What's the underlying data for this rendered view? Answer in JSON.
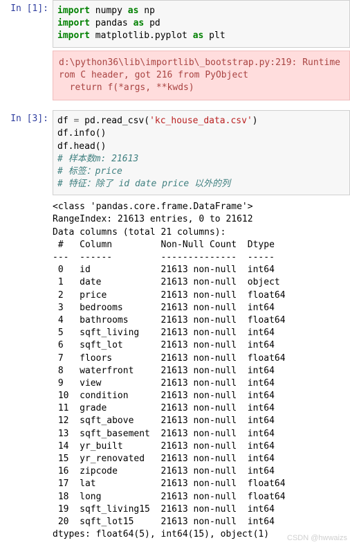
{
  "cell1": {
    "prompt": "In  [1]:",
    "lines": [
      {
        "kw": "import",
        "name": " numpy ",
        "as": "as",
        "alias": " np"
      },
      {
        "kw": "import",
        "name": " pandas ",
        "as": "as",
        "alias": " pd"
      },
      {
        "kw": "import",
        "name": " matplotlib.pyplot ",
        "as": "as",
        "alias": " plt"
      }
    ]
  },
  "warning": {
    "line1": "d:\\python36\\lib\\importlib\\_bootstrap.py:219: Runtime",
    "line2": "rom C header, got 216 from PyObject",
    "line3": "  return f(*args, **kwds)"
  },
  "cell3": {
    "prompt": "In  [3]:",
    "line1_pre": "df ",
    "line1_eq": "=",
    "line1_mid": " pd.read_csv(",
    "line1_str": "'kc_house_data.csv'",
    "line1_end": ")",
    "line2": "df.info()",
    "line3": "df.head()",
    "line4": "# 样本数m: 21613",
    "line5": "# 标签：price",
    "line6": "# 特征：除了 id date price 以外的列"
  },
  "output": {
    "header1": "<class 'pandas.core.frame.DataFrame'>",
    "header2": "RangeIndex: 21613 entries, 0 to 21612",
    "header3": "Data columns (total 21 columns):",
    "colhead": " #   Column         Non-Null Count  Dtype  ",
    "dashline": "---  ------         --------------  -----  ",
    "rows": [
      " 0   id             21613 non-null  int64  ",
      " 1   date           21613 non-null  object ",
      " 2   price          21613 non-null  float64",
      " 3   bedrooms       21613 non-null  int64  ",
      " 4   bathrooms      21613 non-null  float64",
      " 5   sqft_living    21613 non-null  int64  ",
      " 6   sqft_lot       21613 non-null  int64  ",
      " 7   floors         21613 non-null  float64",
      " 8   waterfront     21613 non-null  int64  ",
      " 9   view           21613 non-null  int64  ",
      " 10  condition      21613 non-null  int64  ",
      " 11  grade          21613 non-null  int64  ",
      " 12  sqft_above     21613 non-null  int64  ",
      " 13  sqft_basement  21613 non-null  int64  ",
      " 14  yr_built       21613 non-null  int64  ",
      " 15  yr_renovated   21613 non-null  int64  ",
      " 16  zipcode        21613 non-null  int64  ",
      " 17  lat            21613 non-null  float64",
      " 18  long           21613 non-null  float64",
      " 19  sqft_living15  21613 non-null  int64  ",
      " 20  sqft_lot15     21613 non-null  int64  "
    ],
    "footer": "dtypes: float64(5), int64(15), object(1)"
  },
  "watermark": "CSDN @hwwaizs"
}
